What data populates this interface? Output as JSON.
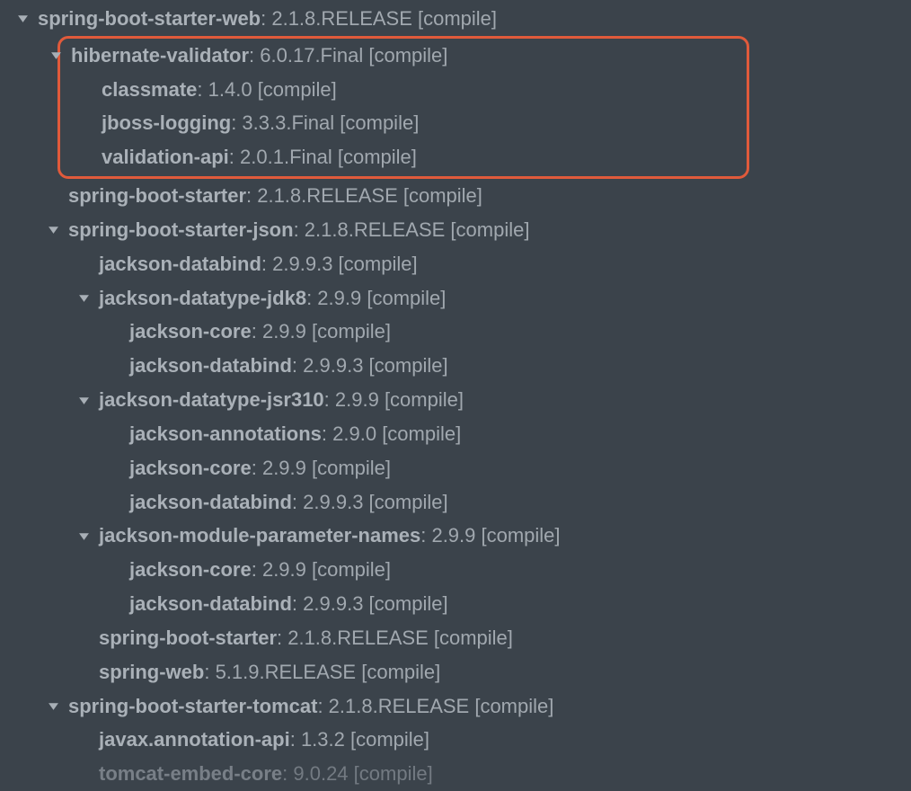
{
  "tree": [
    {
      "name": "spring-boot-starter-web",
      "meta": " : 2.1.8.RELEASE [compile]",
      "expanded": true,
      "children": [
        {
          "highlight": true,
          "name": "hibernate-validator",
          "meta": " : 6.0.17.Final [compile]",
          "expanded": true,
          "children": [
            {
              "name": "classmate",
              "meta": " : 1.4.0 [compile]"
            },
            {
              "name": "jboss-logging",
              "meta": " : 3.3.3.Final [compile]"
            },
            {
              "name": "validation-api",
              "meta": " : 2.0.1.Final [compile]"
            }
          ]
        },
        {
          "name": "spring-boot-starter",
          "meta": " : 2.1.8.RELEASE [compile]"
        },
        {
          "name": "spring-boot-starter-json",
          "meta": " : 2.1.8.RELEASE [compile]",
          "expanded": true,
          "children": [
            {
              "name": "jackson-databind",
              "meta": " : 2.9.9.3 [compile]"
            },
            {
              "name": "jackson-datatype-jdk8",
              "meta": " : 2.9.9 [compile]",
              "expanded": true,
              "children": [
                {
                  "name": "jackson-core",
                  "meta": " : 2.9.9 [compile]"
                },
                {
                  "name": "jackson-databind",
                  "meta": " : 2.9.9.3 [compile]"
                }
              ]
            },
            {
              "name": "jackson-datatype-jsr310",
              "meta": " : 2.9.9 [compile]",
              "expanded": true,
              "children": [
                {
                  "name": "jackson-annotations",
                  "meta": " : 2.9.0 [compile]"
                },
                {
                  "name": "jackson-core",
                  "meta": " : 2.9.9 [compile]"
                },
                {
                  "name": "jackson-databind",
                  "meta": " : 2.9.9.3 [compile]"
                }
              ]
            },
            {
              "name": "jackson-module-parameter-names",
              "meta": " : 2.9.9 [compile]",
              "expanded": true,
              "children": [
                {
                  "name": "jackson-core",
                  "meta": " : 2.9.9 [compile]"
                },
                {
                  "name": "jackson-databind",
                  "meta": " : 2.9.9.3 [compile]"
                }
              ]
            },
            {
              "name": "spring-boot-starter",
              "meta": " : 2.1.8.RELEASE [compile]"
            },
            {
              "name": "spring-web",
              "meta": " : 5.1.9.RELEASE [compile]"
            }
          ]
        },
        {
          "name": "spring-boot-starter-tomcat",
          "meta": " : 2.1.8.RELEASE [compile]",
          "expanded": true,
          "children": [
            {
              "name": "javax.annotation-api",
              "meta": " : 1.3.2 [compile]"
            },
            {
              "name": "tomcat-embed-core",
              "meta": " : 9.0.24 [compile]",
              "cutoff": true
            }
          ]
        }
      ]
    }
  ]
}
